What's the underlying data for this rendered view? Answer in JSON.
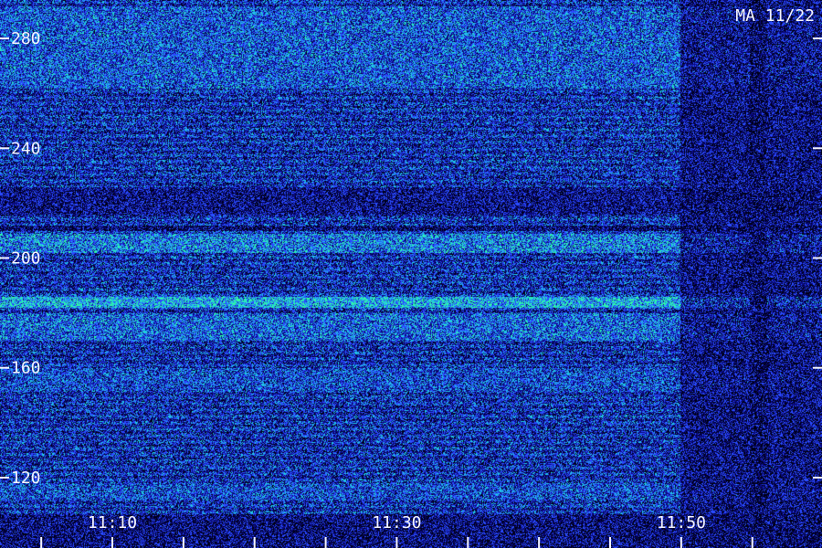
{
  "chart_data": {
    "type": "heatmap",
    "title": "MA 11/22",
    "xlabel": "",
    "ylabel": "",
    "x_ticks": [
      {
        "value": "11:10",
        "minute": 10
      },
      {
        "value": "11:30",
        "minute": 30
      },
      {
        "value": "11:50",
        "minute": 50
      }
    ],
    "xlim_minutes": [
      2.1,
      59.9
    ],
    "y_ticks": [
      120,
      160,
      200,
      240,
      280
    ],
    "ylim": [
      107,
      294
    ],
    "data_end_minute": 49.9,
    "bright_bands": [
      {
        "y_from": 262,
        "y_to": 292,
        "level": 0.55
      },
      {
        "y_from": 202,
        "y_to": 209,
        "level": 0.7
      },
      {
        "y_from": 182,
        "y_to": 186,
        "level": 0.9
      },
      {
        "y_from": 170,
        "y_to": 180,
        "level": 0.6
      },
      {
        "y_from": 152,
        "y_to": 160,
        "level": 0.5
      },
      {
        "y_from": 112,
        "y_to": 118,
        "level": 0.5
      }
    ],
    "dark_bands": [
      {
        "y_from": 216,
        "y_to": 226,
        "level": 0.15
      },
      {
        "y_from": 210,
        "y_to": 212,
        "level": 0.05
      }
    ],
    "colors": {
      "background": "#000010",
      "low": "#0a0a80",
      "mid": "#2a4cff",
      "high": "#20e0e0",
      "peak": "#30ff90",
      "text": "#f4f4ff"
    }
  }
}
